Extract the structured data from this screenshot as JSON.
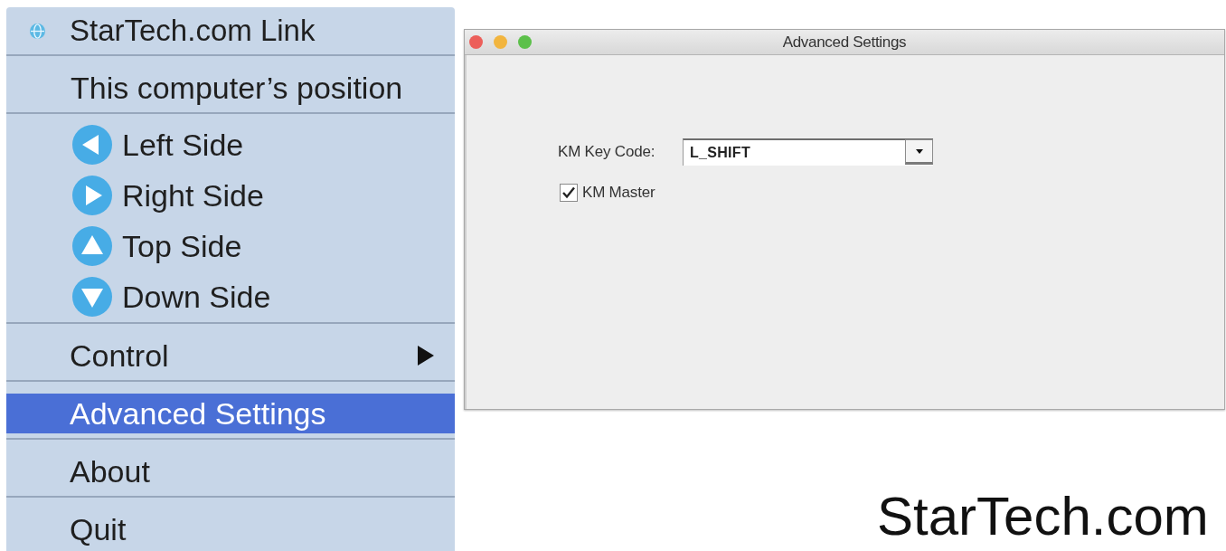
{
  "menu": {
    "title": "StarTech.com Link",
    "section_label": "This computer’s position",
    "positions": [
      {
        "label": "Left Side",
        "kind": "left",
        "selected": false
      },
      {
        "label": "Right Side",
        "kind": "right",
        "selected": false
      },
      {
        "label": "Top Side",
        "kind": "up",
        "selected": false
      },
      {
        "label": "Down Side",
        "kind": "down",
        "selected": false
      }
    ],
    "items": [
      {
        "label": "Control",
        "kind": "submenu",
        "selected": false
      },
      {
        "label": "Advanced Settings",
        "kind": "action",
        "selected": true
      },
      {
        "label": "About",
        "kind": "action",
        "selected": false
      },
      {
        "label": "Quit",
        "kind": "action",
        "selected": false
      }
    ]
  },
  "window": {
    "title": "Advanced Settings",
    "key_code": {
      "label": "KM Key Code:",
      "value": "L_SHIFT"
    },
    "master": {
      "label": "KM Master",
      "checked": true
    }
  },
  "brand_text": "StarTech.com"
}
